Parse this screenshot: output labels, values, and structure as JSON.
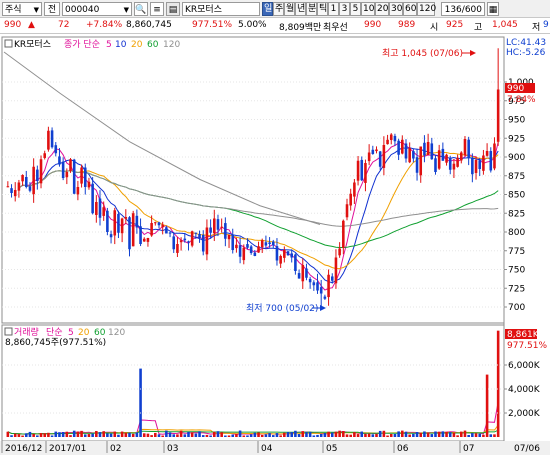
{
  "toolbar": {
    "market": "주식",
    "all": "전",
    "code": "000040",
    "name": "KR모터스",
    "periods": [
      "일",
      "주",
      "월",
      "년",
      "분",
      "틱",
      "1",
      "3",
      "5",
      "10",
      "20",
      "30",
      "60",
      "120"
    ],
    "selected_period": "일",
    "count": "136/600"
  },
  "quote": {
    "price": "990",
    "change": "72",
    "rate": "+7.84%",
    "volume": "8,860,745",
    "vol_ratio": "977.51%",
    "turnover_rate": "5.00%",
    "amount": "8,809백만",
    "investor": "최우선",
    "ask": "990",
    "bid": "989",
    "open_label": "시",
    "open": "925",
    "high_label": "고",
    "high": "1,045",
    "low_label": "저",
    "low": "9"
  },
  "price_panel": {
    "legend": {
      "name": "KR모터스",
      "type": "종가 단순",
      "ma": [
        "5",
        "10",
        "20",
        "60",
        "120"
      ]
    },
    "lc": "LC:41.43",
    "hc": "HC:-5.26",
    "current_tag": "990",
    "current_rate": "7.84%",
    "axis_ticks": [
      "1,000",
      "975",
      "950",
      "925",
      "900",
      "875",
      "850",
      "825",
      "800",
      "775",
      "750",
      "725",
      "700"
    ],
    "high_note": "최고 1,045 (07/06)",
    "low_note": "최저 700 (05/02)"
  },
  "volume_panel": {
    "legend": {
      "name": "거래량",
      "type": "단순",
      "ma": [
        "5",
        "20",
        "60",
        "120"
      ]
    },
    "value_text": "8,860,745주(977.51%)",
    "current_tag": "8,861K",
    "current_rate": "977.51%",
    "axis_ticks": [
      "6,000K",
      "4,000K",
      "2,000K"
    ]
  },
  "x_axis": {
    "labels": [
      "2016/12",
      "2017/01",
      "02",
      "03",
      "04",
      "05",
      "06",
      "07"
    ],
    "right_label": "07/06"
  },
  "colors": {
    "up": "#e01010",
    "down": "#1040d0",
    "ma5": "#e0109a",
    "ma10": "#1030d0",
    "ma20": "#f0a000",
    "ma60": "#10a030",
    "ma120": "#909090",
    "tag_bg": "#e01010"
  },
  "chart_data": {
    "type": "candlestick",
    "series_close": [
      861,
      852,
      856,
      866,
      876,
      860,
      855,
      887,
      868,
      897,
      905,
      935,
      913,
      905,
      890,
      872,
      880,
      897,
      851,
      860,
      886,
      860,
      867,
      825,
      840,
      819,
      833,
      800,
      793,
      829,
      799,
      818,
      820,
      777,
      825,
      806,
      784,
      791,
      792,
      812,
      813,
      809,
      810,
      798,
      798,
      777,
      784,
      789,
      789,
      786,
      801,
      798,
      792,
      774,
      806,
      799,
      818,
      803,
      807,
      791,
      796,
      776,
      783,
      767,
      779,
      779,
      772,
      768,
      781,
      789,
      782,
      784,
      782,
      762,
      768,
      776,
      769,
      766,
      748,
      738,
      756,
      739,
      733,
      729,
      722,
      718,
      711,
      743,
      735,
      766,
      778,
      815,
      837,
      851,
      866,
      895,
      869,
      892,
      906,
      904,
      910,
      887,
      916,
      923,
      930,
      921,
      903,
      923,
      898,
      912,
      898,
      879,
      914,
      902,
      920,
      897,
      880,
      909,
      895,
      903,
      883,
      891,
      899,
      906,
      924,
      899,
      877,
      896,
      884,
      902,
      908,
      882,
      918,
      990
    ],
    "volume_peaks_k": [
      {
        "bar": "2017/03",
        "value": 5700
      },
      {
        "bar": "2017/07",
        "value": 8861
      },
      {
        "bar": "2017/07",
        "value": 5200
      }
    ]
  }
}
